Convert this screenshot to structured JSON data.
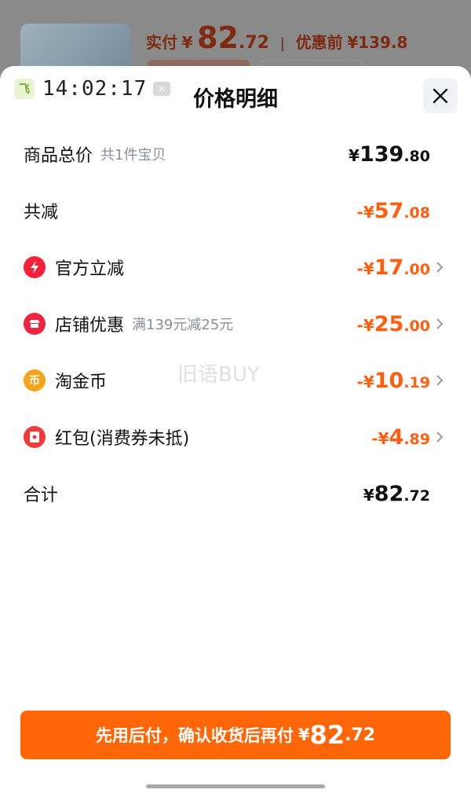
{
  "background": {
    "price_label": "实付",
    "price_yen": "¥",
    "price_int": "82",
    "price_dec": ".72",
    "separator": "|",
    "original_label": "优惠前",
    "original_price": "¥139.8"
  },
  "timer": {
    "logo_text": "飞",
    "time": "14:02:17",
    "close_glyph": "×"
  },
  "sheet": {
    "title": "价格明细"
  },
  "rows": [
    {
      "label": "商品总价",
      "sub": "共1件宝贝",
      "prefix": "",
      "yen": "¥",
      "int": "139",
      "dec": ".80"
    },
    {
      "label": "共减",
      "sub": "",
      "prefix": "-",
      "yen": "¥",
      "int": "57",
      "dec": ".08"
    },
    {
      "label": "官方立减",
      "sub": "",
      "prefix": "-",
      "yen": "¥",
      "int": "17",
      "dec": ".00",
      "icon": "lightning-icon"
    },
    {
      "label": "店铺优惠",
      "sub": "满139元减25元",
      "prefix": "-",
      "yen": "¥",
      "int": "25",
      "dec": ".00",
      "icon": "shop-icon"
    },
    {
      "label": "淘金币",
      "sub": "",
      "prefix": "-",
      "yen": "¥",
      "int": "10",
      "dec": ".19",
      "icon": "coin-icon",
      "icon_text": "币"
    },
    {
      "label": "红包(消费券未抵)",
      "sub": "",
      "prefix": "-",
      "yen": "¥",
      "int": "4",
      "dec": ".89",
      "icon": "red-packet-icon"
    },
    {
      "label": "合计",
      "sub": "",
      "prefix": "",
      "yen": "¥",
      "int": "82",
      "dec": ".72"
    }
  ],
  "watermark": "旧语BUY",
  "pay_button": {
    "text": "先用后付，确认收货后再付",
    "yen": "¥",
    "int": "82",
    "dec": ".72"
  },
  "colors": {
    "accent": "#ff6607",
    "discount": "#ff5e0e",
    "lightning": "#f5203a",
    "shop": "#f0243f",
    "coin": "#f7a21b",
    "red_packet": "#f23a3a"
  }
}
